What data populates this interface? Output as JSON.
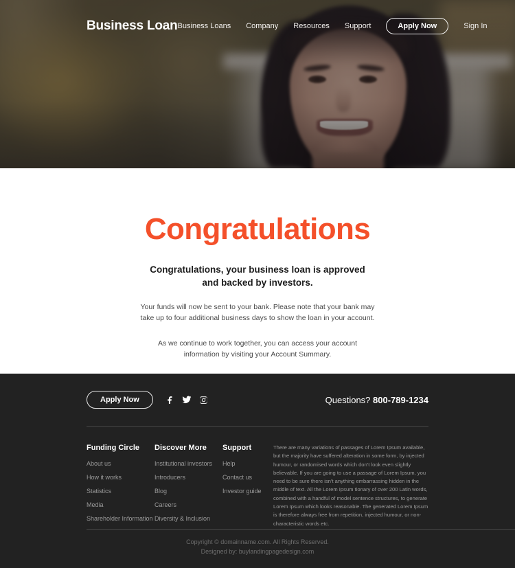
{
  "nav": {
    "brand": "Business Loan",
    "links": [
      {
        "label": "Business Loans"
      },
      {
        "label": "Company"
      },
      {
        "label": "Resources"
      },
      {
        "label": "Support"
      }
    ],
    "cta_label": "Apply Now",
    "signin_label": "Sign In"
  },
  "main": {
    "title": "Congratulations",
    "title_color": "#f4502a",
    "subtitle_line1": "Congratulations, your business loan is approved",
    "subtitle_line2": "and backed by investors.",
    "paragraph1": "Your funds will now be sent to your bank. Please note that your bank may take up to four additional business days to show the loan in your account.",
    "paragraph2": "As we continue to work together, you can access your account information by visiting your Account Summary."
  },
  "footer": {
    "background": "#222222",
    "cta_label": "Apply Now",
    "socials": [
      {
        "name": "facebook-icon"
      },
      {
        "name": "twitter-icon"
      },
      {
        "name": "instagram-icon"
      }
    ],
    "questions_label": "Questions?",
    "phone": "800-789-1234",
    "columns": [
      {
        "title": "Funding Circle",
        "links": [
          "About us",
          "How it works",
          "Statistics",
          "Media",
          "Shareholder Information"
        ]
      },
      {
        "title": "Discover More",
        "links": [
          "Institutional investors",
          "Introducers",
          "Blog",
          "Careers",
          "Diversity & Inclusion"
        ]
      },
      {
        "title": "Support",
        "links": [
          "Help",
          "Contact us",
          "Investor guide"
        ]
      }
    ],
    "paragraph": "There are many variations of passages of Lorem Ipsum available, but the majority have suffered alteration in some form, by injected humour, or randomised words which don't look even slightly believable. If you are going to use a passage of Lorem Ipsum, you need to be sure there isn't anything embarrassing hidden in the middle of text. All the Lorem Ipsum tionary of over 200 Latin words, combined with a handful of model sentence structures, to generate Lorem Ipsum which looks reasonable. The generated Lorem Ipsum is therefore always free from repetition, injected humour, or non-characteristic words etc.",
    "copyright": "Copyright © domainname.com. All Rights Reserved.",
    "designed_by_prefix": "Designed by: ",
    "designed_by_link": "buylandingpagedesign.com"
  }
}
